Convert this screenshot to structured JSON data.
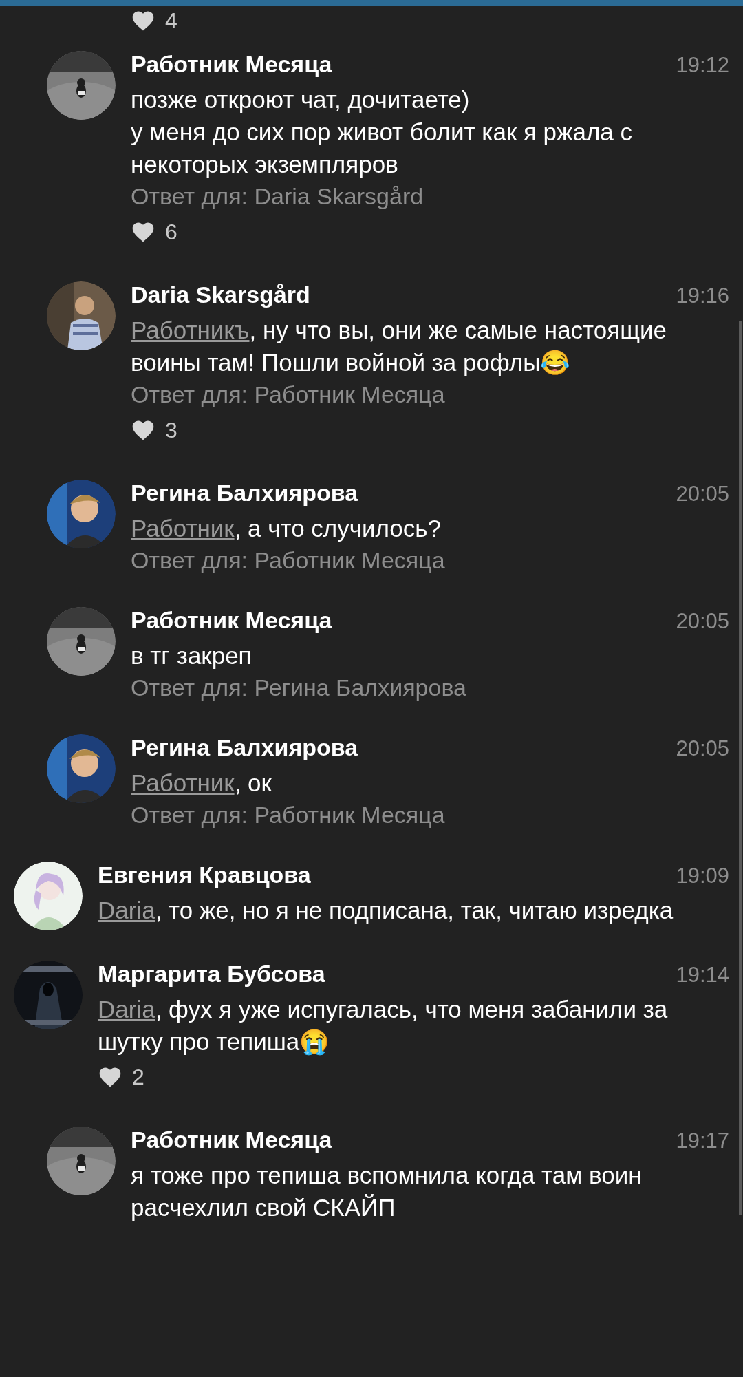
{
  "earlier_replies": {
    "top_likes": "4",
    "replies": [
      {
        "author": "Работник Месяца",
        "time": "19:12",
        "text": "позже откроют чат, дочитаете)\nу меня до сих пор живот болит как я ржала с некоторых экземпляров",
        "reply_to": "Ответ для: Daria Skarsgård",
        "likes": "6"
      },
      {
        "author": "Daria Skarsgård",
        "time": "19:16",
        "mention": "Работникъ",
        "text": ", ну что вы, они же самые настоящие воины там! Пошли войной за рофлы😂",
        "reply_to": "Ответ для: Работник Месяца",
        "likes": "3"
      },
      {
        "author": "Регина Балхиярова",
        "time": "20:05",
        "mention": "Работник",
        "text": ", а что случилось?",
        "reply_to": "Ответ для: Работник Месяца"
      },
      {
        "author": "Работник Месяца",
        "time": "20:05",
        "text": "в тг закреп",
        "reply_to": "Ответ для: Регина Балхиярова"
      },
      {
        "author": "Регина Балхиярова",
        "time": "20:05",
        "mention": "Работник",
        "text": ", ок",
        "reply_to": "Ответ для: Работник Месяца"
      }
    ]
  },
  "comments": [
    {
      "author": "Евгения Кравцова",
      "time": "19:09",
      "mention": "Daria",
      "text": ", то же, но я не подписана, так, читаю изредка"
    },
    {
      "author": "Маргарита Бубсова",
      "time": "19:14",
      "mention": "Daria",
      "text": ", фух я уже испугалась, что меня забанили за шутку про тепиша😭",
      "likes": "2",
      "replies": [
        {
          "author": "Работник Месяца",
          "time": "19:17",
          "text": "я тоже про тепиша вспомнила когда там воин расчехлил свой СКАЙП"
        }
      ]
    }
  ]
}
